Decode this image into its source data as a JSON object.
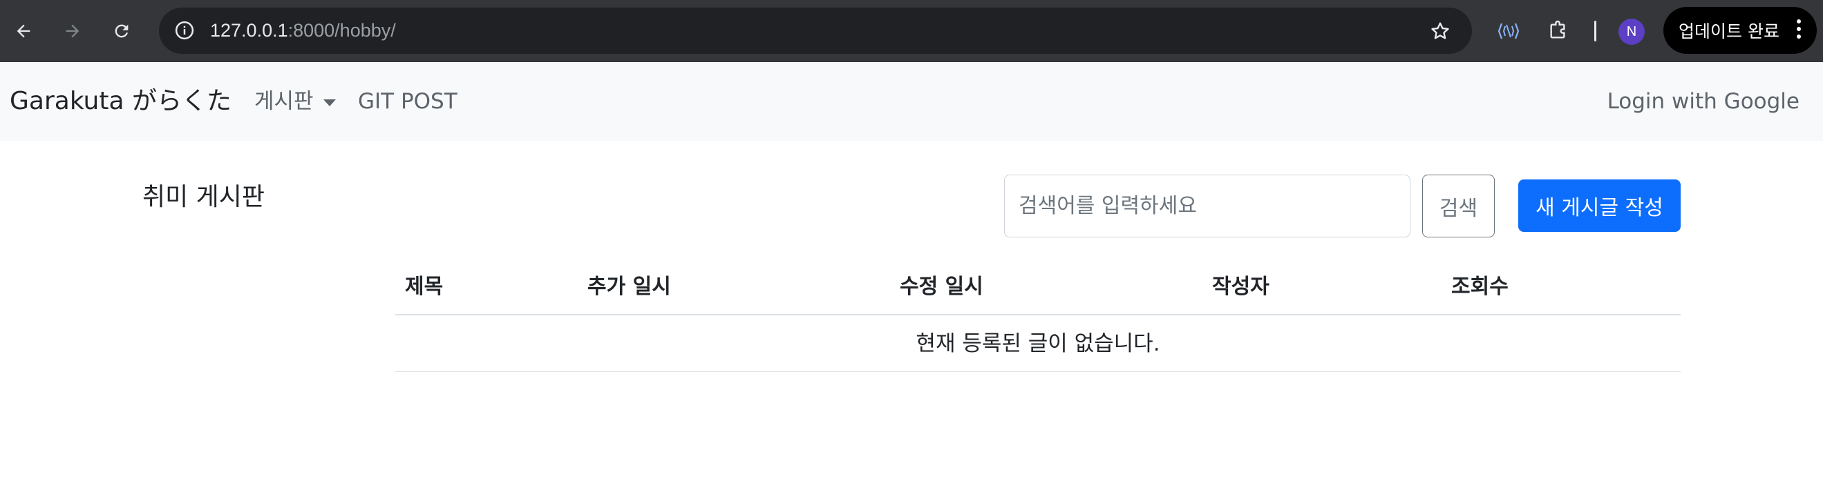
{
  "browser": {
    "url_host": "127.0.0.1",
    "url_rest": ":8000/hobby/",
    "profile_initial": "N",
    "update_label": "업데이트 완료"
  },
  "navbar": {
    "brand": "Garakuta がらくた",
    "board_menu": "게시판",
    "git_post": "GIT POST",
    "login": "Login with Google"
  },
  "page": {
    "title": "취미 게시판",
    "search_placeholder": "검색어를 입력하세요",
    "search_value": "",
    "search_button": "검색",
    "new_post_button": "새 게시글 작성"
  },
  "table": {
    "columns": [
      "제목",
      "추가 일시",
      "수정 일시",
      "작성자",
      "조회수"
    ],
    "empty_message": "현재 등록된 글이 없습니다."
  }
}
